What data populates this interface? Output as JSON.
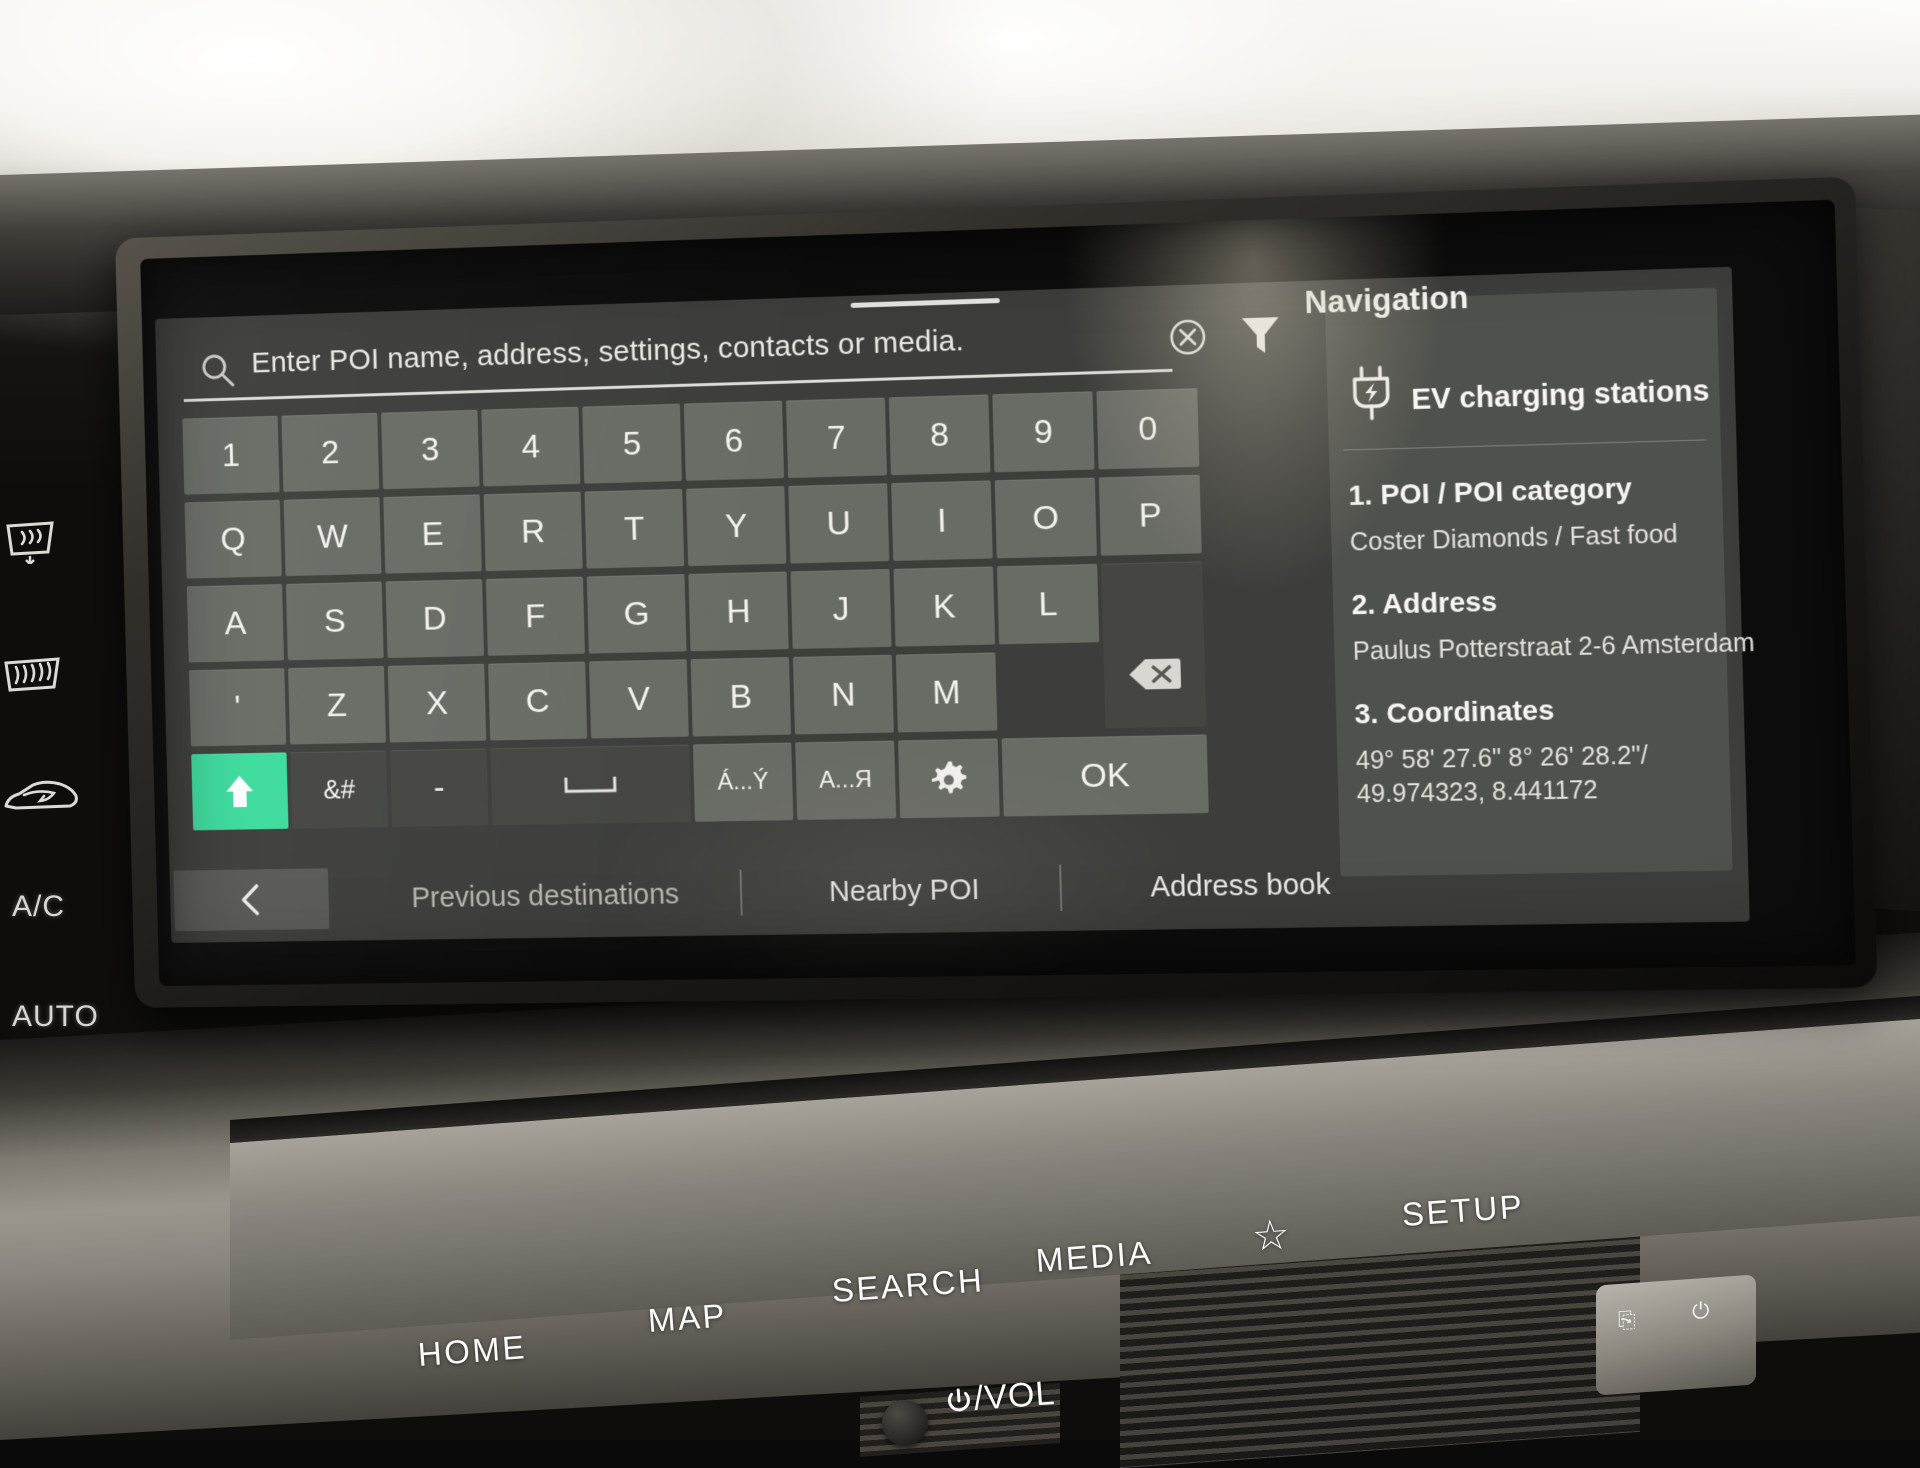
{
  "device": {
    "type": "car-infotainment-head-unit",
    "accent_green": "#3ddb9e",
    "panel_gray": "#424440",
    "key_gray": "#84877f"
  },
  "screen": {
    "search": {
      "placeholder": "Enter POI name, address, settings, contacts or media.",
      "value": "",
      "icon": "search-icon",
      "clear_icon": "clear-circle-x-icon",
      "filter_icon": "filter-funnel-icon"
    },
    "keyboard": {
      "row_numbers": [
        "1",
        "2",
        "3",
        "4",
        "5",
        "6",
        "7",
        "8",
        "9",
        "0"
      ],
      "row_top": [
        "Q",
        "W",
        "E",
        "R",
        "T",
        "Y",
        "U",
        "I",
        "O",
        "P"
      ],
      "row_home": [
        "A",
        "S",
        "D",
        "F",
        "G",
        "H",
        "J",
        "K",
        "L"
      ],
      "row_bottom": [
        "'",
        "Z",
        "X",
        "C",
        "V",
        "B",
        "N",
        "M"
      ],
      "backspace_label": "backspace-icon",
      "func_row": {
        "shift": "shift-up-arrow-icon",
        "symbols": "&#",
        "hyphen": "-",
        "space": "space-bar-icon",
        "latin_accents": "Á...Ý",
        "cyrillic": "А...Я",
        "settings": "gear-icon",
        "ok": "OK"
      },
      "accent_keys": [
        "W",
        "E",
        "R",
        "T",
        "Y",
        "U",
        "I",
        "O",
        "A",
        "S",
        "D",
        "G",
        "Z",
        "C",
        "N"
      ]
    },
    "tabs": [
      {
        "label": "Previous destinations",
        "active": false
      },
      {
        "label": "Nearby POI",
        "active": true
      },
      {
        "label": "Address book",
        "active": true
      }
    ],
    "back_button": {
      "icon": "chevron-left-icon",
      "label": "<"
    },
    "nav_panel": {
      "title": "Navigation",
      "ev_item": {
        "icon": "ev-plug-icon",
        "label": "EV charging stations"
      },
      "sections": [
        {
          "heading": "1. POI / POI category",
          "value": "Coster Diamonds / Fast food"
        },
        {
          "heading": "2. Address",
          "value": "Paulus Potterstraat 2-6 Amsterdam"
        },
        {
          "heading": "3. Coordinates",
          "value": "49° 58' 27.6\" 8° 26' 28.2\"/\n49.974323, 8.441172",
          "line1": "49° 58' 27.6\" 8° 26' 28.2\"/",
          "line2": "49.974323, 8.441172"
        }
      ]
    }
  },
  "hardware": {
    "climate": [
      {
        "name": "front-defrost",
        "label": ""
      },
      {
        "name": "rear-defrost",
        "label": ""
      },
      {
        "name": "air-recirculation",
        "label": ""
      },
      {
        "name": "ac-toggle",
        "label": "A/C"
      },
      {
        "name": "auto-climate",
        "label": "AUTO"
      }
    ],
    "buttons": [
      {
        "name": "home",
        "label": "HOME"
      },
      {
        "name": "map",
        "label": "MAP"
      },
      {
        "name": "search",
        "label": "SEARCH"
      },
      {
        "name": "media",
        "label": "MEDIA"
      },
      {
        "name": "favorites",
        "label": "☆"
      },
      {
        "name": "setup",
        "label": "SETUP"
      }
    ],
    "volume_knob": {
      "label": "/VOL",
      "power_icon": "power-icon"
    }
  }
}
